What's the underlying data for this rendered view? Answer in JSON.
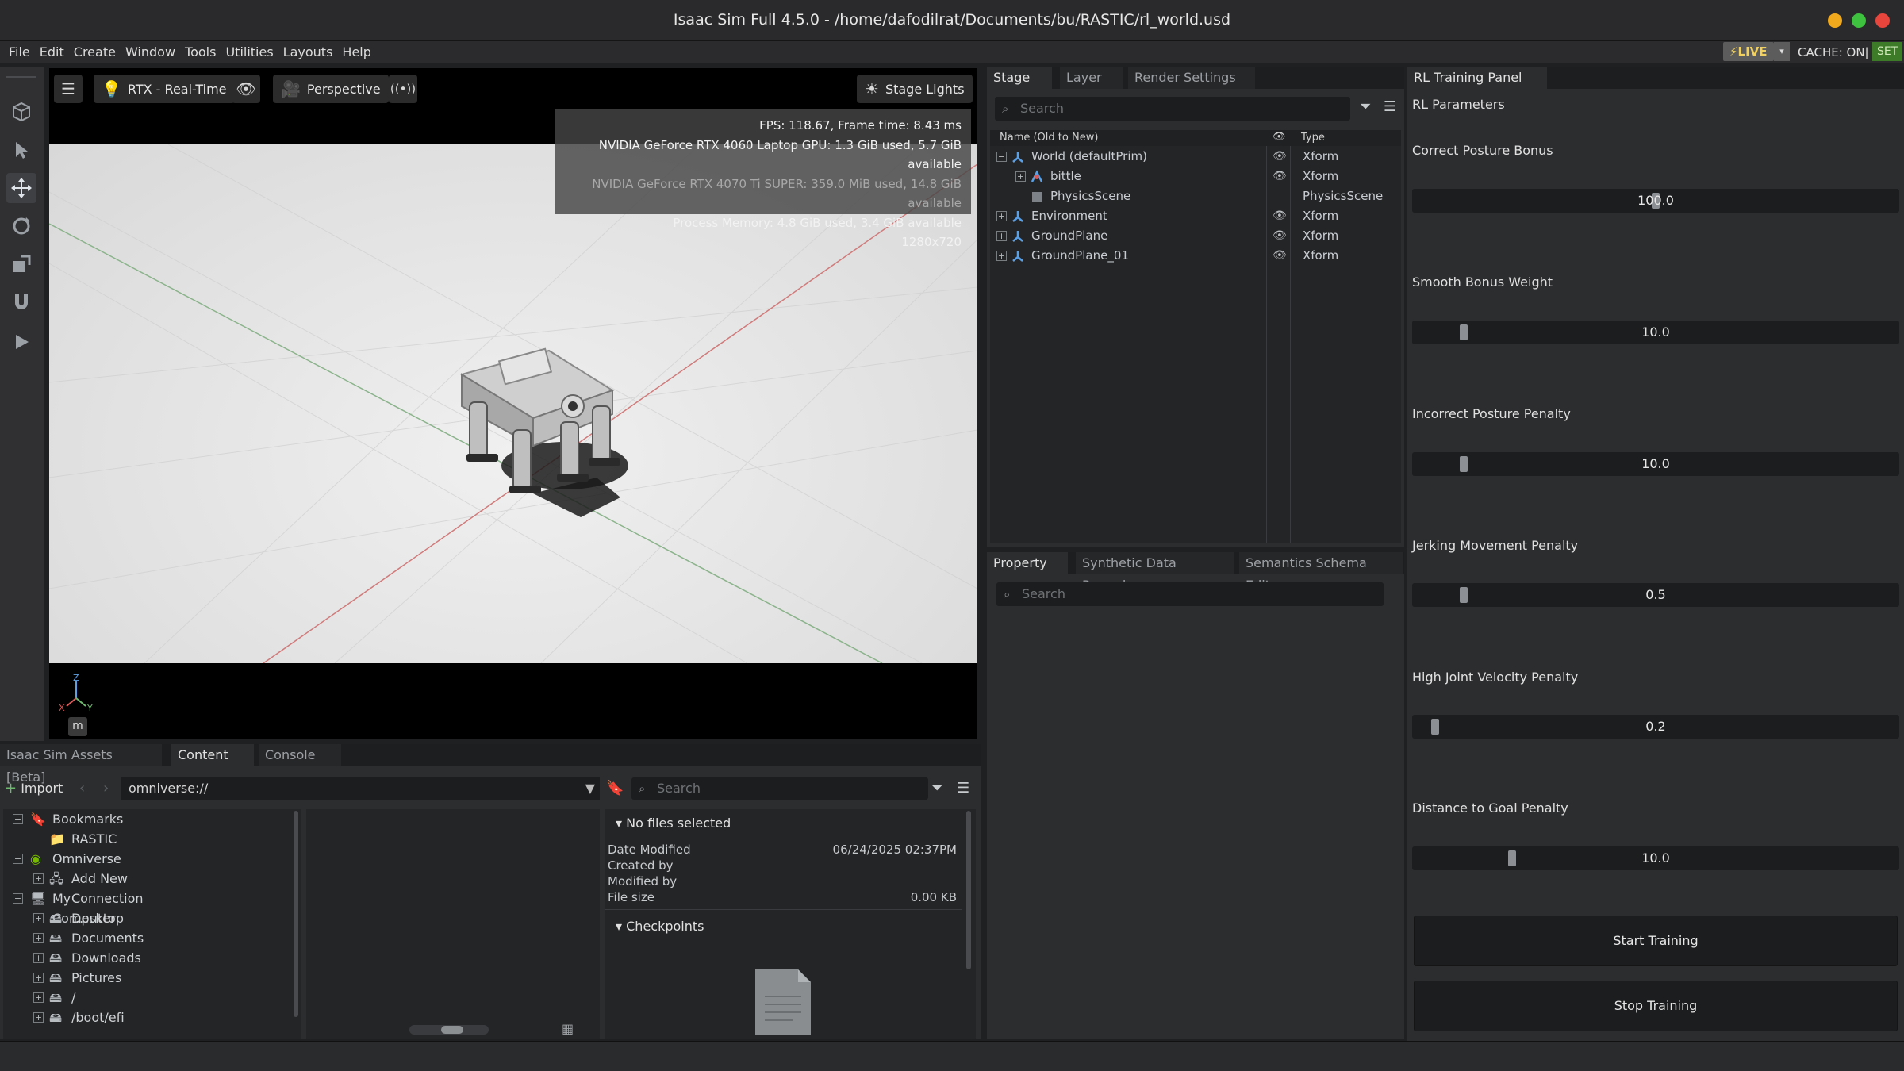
{
  "window": {
    "title": "Isaac Sim Full 4.5.0 - /home/dafodilrat/Documents/bu/RASTIC/rl_world.usd"
  },
  "menu": {
    "items": [
      "File",
      "Edit",
      "Create",
      "Window",
      "Tools",
      "Utilities",
      "Layouts",
      "Help"
    ],
    "live_label": "LIVE",
    "cache_label": "CACHE: ON|",
    "set_label": "SET"
  },
  "viewport": {
    "renderer_label": "RTX - Real-Time",
    "camera_label": "Perspective",
    "lights_label": "Stage Lights",
    "stats": {
      "fps": "FPS: 118.67, Frame time: 8.43 ms",
      "gpu1": "NVIDIA GeForce RTX 4060 Laptop GPU: 1.3 GiB used, 5.7 GiB available",
      "gpu2": "NVIDIA GeForce RTX 4070 Ti SUPER: 359.0 MiB used, 14.8 GiB available",
      "memory": "Process Memory: 4.8 GiB used, 3.4 GiB available",
      "resolution": "1280x720"
    },
    "axis_z": "Z",
    "axis_x": "X",
    "axis_y": "Y",
    "unit": "m"
  },
  "stage": {
    "tabs": [
      "Stage",
      "Layer",
      "Render Settings"
    ],
    "search_placeholder": "Search",
    "col_name": "Name (Old to New)",
    "col_type": "Type",
    "rows": [
      {
        "name": "World (defaultPrim)",
        "type": "Xform",
        "icon": "xform-icon"
      },
      {
        "name": "bittle",
        "type": "Xform",
        "icon": "articulation-icon"
      },
      {
        "name": "PhysicsScene",
        "type": "PhysicsScene",
        "icon": "physics-cube-icon"
      },
      {
        "name": "Environment",
        "type": "Xform",
        "icon": "xform-icon"
      },
      {
        "name": "GroundPlane",
        "type": "Xform",
        "icon": "xform-icon"
      },
      {
        "name": "GroundPlane_01",
        "type": "Xform",
        "icon": "xform-icon"
      }
    ]
  },
  "property": {
    "tabs": [
      "Property",
      "Synthetic Data Recorder",
      "Semantics Schema Edit..."
    ],
    "search_placeholder": "Search"
  },
  "rl_panel": {
    "tab": "RL Training Panel",
    "section": "RL Parameters",
    "params": [
      {
        "label": "Correct Posture Bonus",
        "value": "100.0",
        "fraction": 0.5
      },
      {
        "label": "Smooth Bonus Weight",
        "value": "10.0",
        "fraction": 0.1
      },
      {
        "label": "Incorrect Posture Penalty",
        "value": "10.0",
        "fraction": 0.1
      },
      {
        "label": "Jerking Movement Penalty",
        "value": "0.5",
        "fraction": 0.1
      },
      {
        "label": "High Joint Velocity Penalty",
        "value": "0.2",
        "fraction": 0.04
      },
      {
        "label": "Distance to Goal Penalty",
        "value": "10.0",
        "fraction": 0.2
      }
    ],
    "start_label": "Start Training",
    "stop_label": "Stop Training"
  },
  "content": {
    "tabs": [
      "Isaac Sim Assets [Beta]",
      "Content",
      "Console"
    ],
    "import_label": "Import",
    "path": "omniverse://",
    "search_placeholder": "Search",
    "tree": [
      {
        "label": "Bookmarks",
        "icon": "bookmark-icon",
        "level": 0,
        "expander": "−"
      },
      {
        "label": "RASTIC",
        "icon": "folder-icon",
        "level": 1,
        "expander": ""
      },
      {
        "label": "Omniverse",
        "icon": "omniverse-icon",
        "level": 0,
        "expander": "−"
      },
      {
        "label": "Add New Connection ...",
        "icon": "server-icon",
        "level": 1,
        "expander": "+"
      },
      {
        "label": "My Computer",
        "icon": "computer-icon",
        "level": 0,
        "expander": "−"
      },
      {
        "label": "Desktop",
        "icon": "drive-icon",
        "level": 1,
        "expander": "+"
      },
      {
        "label": "Documents",
        "icon": "drive-icon",
        "level": 1,
        "expander": "+"
      },
      {
        "label": "Downloads",
        "icon": "drive-icon",
        "level": 1,
        "expander": "+"
      },
      {
        "label": "Pictures",
        "icon": "drive-icon",
        "level": 1,
        "expander": "+"
      },
      {
        "label": "/",
        "icon": "drive-icon",
        "level": 1,
        "expander": "+"
      },
      {
        "label": "/boot/efi",
        "icon": "drive-icon",
        "level": 1,
        "expander": "+"
      }
    ],
    "details": {
      "header": "No files selected",
      "date_modified_label": "Date Modified",
      "date_modified_value": "06/24/2025 02:37PM",
      "created_by_label": "Created by",
      "modified_by_label": "Modified by",
      "file_size_label": "File size",
      "file_size_value": "0.00 KB",
      "checkpoints_label": "Checkpoints"
    }
  },
  "colors": {
    "accent": "#f0d060",
    "set_green": "#3d7b28",
    "panel_bg": "#2c2d2f",
    "axis_x": "#d65a5a",
    "axis_y": "#6fb86f",
    "axis_z": "#5aa0e6"
  }
}
